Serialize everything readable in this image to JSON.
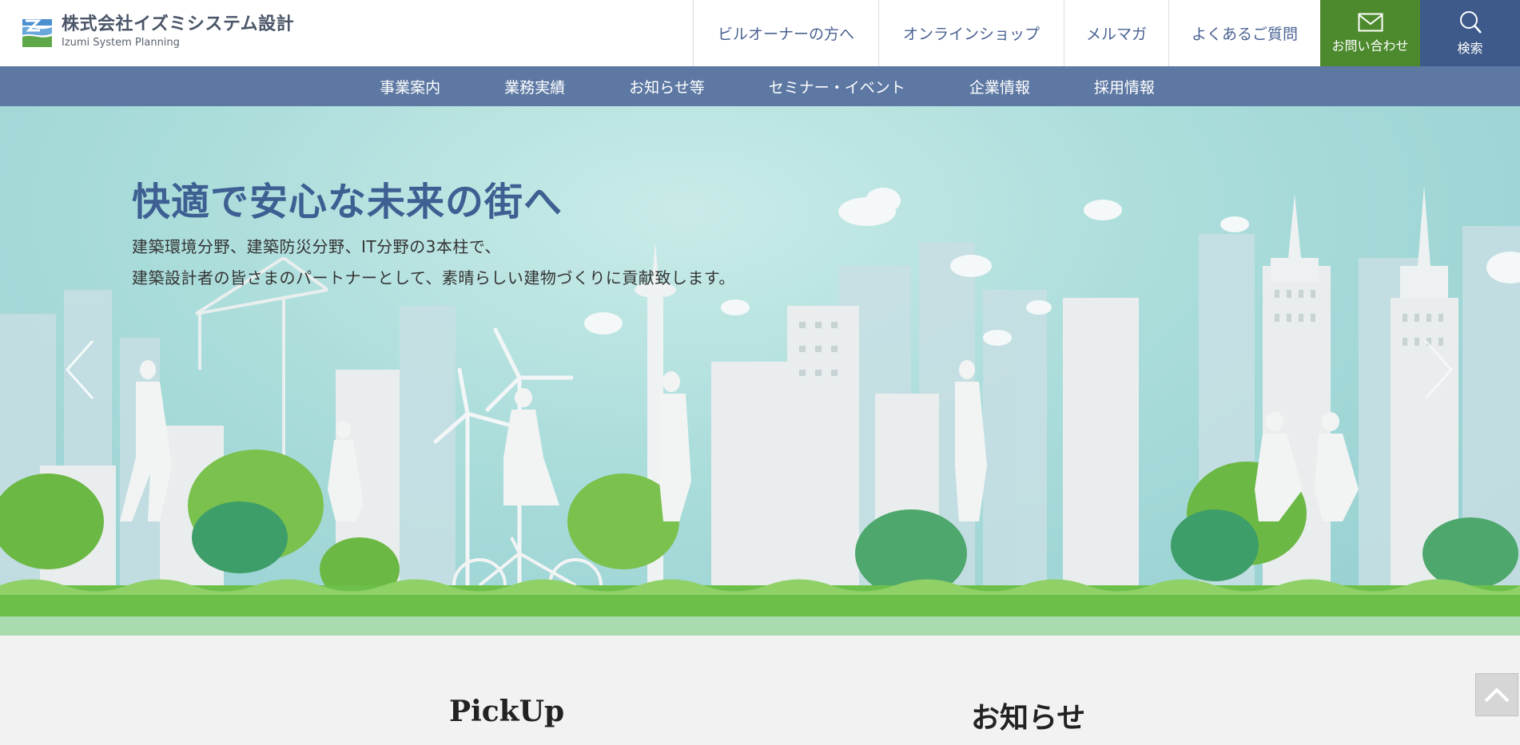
{
  "header": {
    "logo_jp": "株式会社イズミシステム設計",
    "logo_en": "Izumi System Planning",
    "nav": [
      {
        "label": "ビルオーナーの方へ"
      },
      {
        "label": "オンラインショップ"
      },
      {
        "label": "メルマガ"
      },
      {
        "label": "よくあるご質問"
      }
    ],
    "contact_label": "お問い合わせ",
    "search_label": "検索",
    "colors": {
      "contact": "#4d8a2e",
      "search": "#3e5a8a",
      "nav_text": "#4a6291"
    }
  },
  "mainnav": {
    "items": [
      {
        "label": "事業案内"
      },
      {
        "label": "業務実績"
      },
      {
        "label": "お知らせ等"
      },
      {
        "label": "セミナー・イベント"
      },
      {
        "label": "企業情報"
      },
      {
        "label": "採用情報"
      }
    ],
    "color": "#5d78a3"
  },
  "hero": {
    "title": "快適で安心な未来の街へ",
    "line1": "建築環境分野、建築防災分野、IT分野の3本柱で、",
    "line2": "建築設計者の皆さまのパートナーとして、素晴らしい建物づくりに貢献致します。"
  },
  "sections": {
    "pickup_title": "PickUp",
    "news_title": "お知らせ"
  },
  "icons": {
    "mail": "mail-icon",
    "search": "search-icon",
    "to_top": "chevron-up-icon",
    "slider_prev": "chevron-left-icon",
    "slider_next": "chevron-right-icon"
  }
}
